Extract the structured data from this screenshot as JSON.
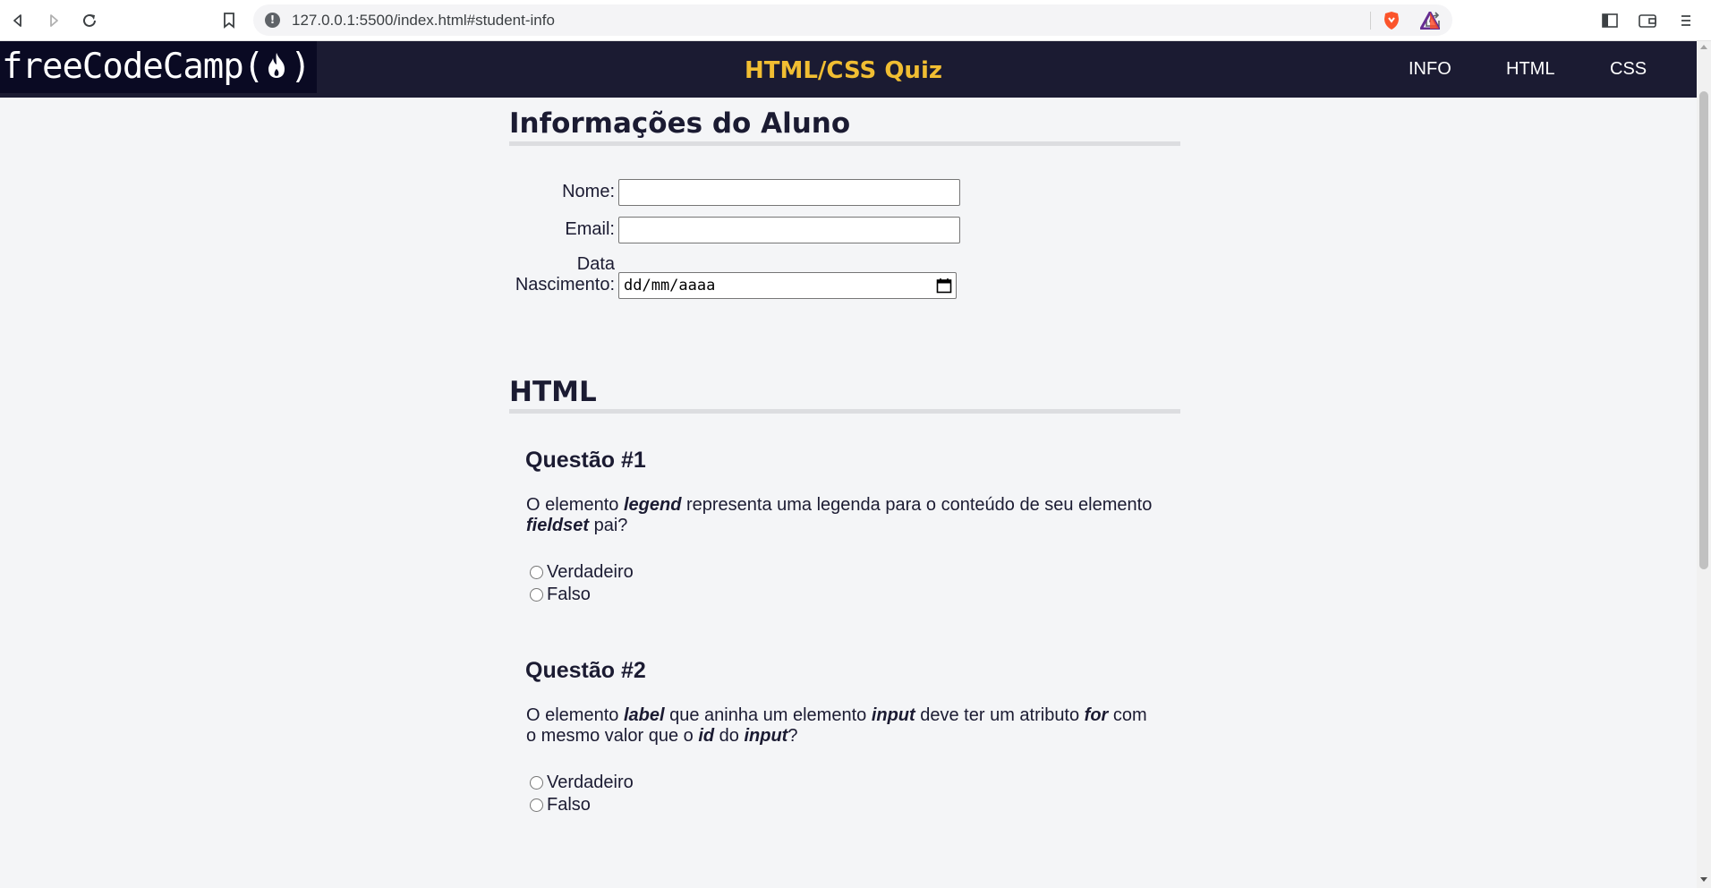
{
  "browser": {
    "url": "127.0.0.1:5500/index.html#student-info"
  },
  "navbar": {
    "logo": "freeCodeCamp",
    "title": "HTML/CSS Quiz",
    "links": [
      "INFO",
      "HTML",
      "CSS"
    ]
  },
  "student_info": {
    "heading": "Informações do Aluno",
    "name_label": "Nome:",
    "email_label": "Email:",
    "birth_label_line1": "Data",
    "birth_label_line2": "Nascimento:",
    "birth_placeholder": "dd/mm/aaaa"
  },
  "html_section": {
    "heading": "HTML",
    "questions": [
      {
        "title": "Questão #1",
        "parts": [
          "O elemento ",
          "legend",
          " representa uma legenda para o conteúdo de seu elemento ",
          "fieldset",
          " pai?"
        ],
        "options": [
          "Verdadeiro",
          "Falso"
        ]
      },
      {
        "title": "Questão #2",
        "parts": [
          "O elemento ",
          "label",
          " que aninha um elemento ",
          "input",
          " deve ter um atributo ",
          "for",
          " com o mesmo valor que o ",
          "id",
          " do ",
          "input",
          "?"
        ],
        "options": [
          "Verdadeiro",
          "Falso"
        ]
      }
    ]
  }
}
